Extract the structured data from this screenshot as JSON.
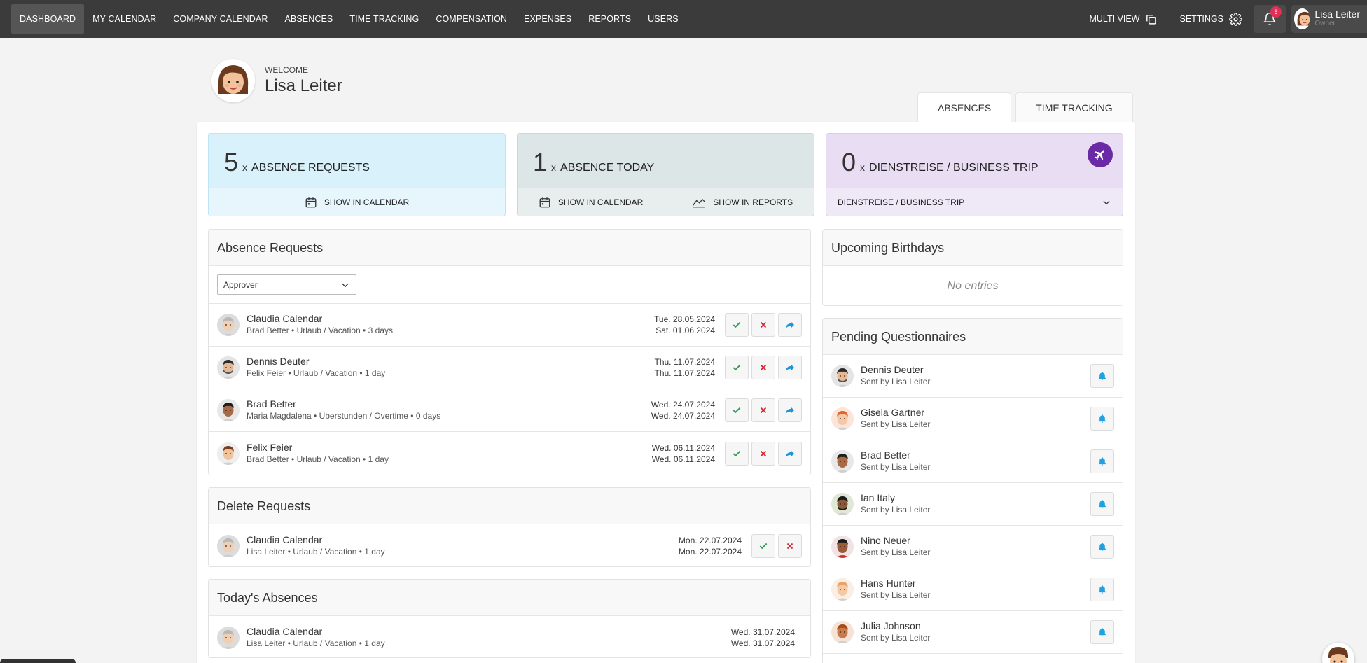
{
  "nav": {
    "items": [
      "DASHBOARD",
      "MY CALENDAR",
      "COMPANY CALENDAR",
      "ABSENCES",
      "TIME TRACKING",
      "COMPENSATION",
      "EXPENSES",
      "REPORTS",
      "USERS"
    ],
    "multi_view": "MULTI VIEW",
    "settings": "SETTINGS",
    "notifications_count": "6",
    "user_name": "Lisa Leiter",
    "user_role": "Owner"
  },
  "welcome": {
    "label": "WELCOME",
    "name": "Lisa Leiter"
  },
  "tabs": {
    "absences": "ABSENCES",
    "time_tracking": "TIME TRACKING"
  },
  "stats": {
    "requests": {
      "count": "5",
      "x": "x",
      "label": "ABSENCE REQUESTS",
      "link1": "SHOW IN CALENDAR"
    },
    "today": {
      "count": "1",
      "x": "x",
      "label": "ABSENCE TODAY",
      "link1": "SHOW IN CALENDAR",
      "link2": "SHOW IN REPORTS"
    },
    "trip": {
      "count": "0",
      "x": "x",
      "label": "DIENSTREISE / BUSINESS TRIP",
      "select": "DIENSTREISE / BUSINESS TRIP"
    }
  },
  "absence_requests": {
    "title": "Absence Requests",
    "filter": "Approver",
    "rows": [
      {
        "name": "Claudia Calendar",
        "sub": "Brad Better • Urlaub / Vacation • 3 days",
        "from": "Tue. 28.05.2024",
        "to": "Sat. 01.06.2024"
      },
      {
        "name": "Dennis Deuter",
        "sub": "Felix Feier • Urlaub / Vacation • 1 day",
        "from": "Thu. 11.07.2024",
        "to": "Thu. 11.07.2024"
      },
      {
        "name": "Brad Better",
        "sub": "Maria Magdalena • Überstunden / Overtime • 0 days",
        "from": "Wed. 24.07.2024",
        "to": "Wed. 24.07.2024"
      },
      {
        "name": "Felix Feier",
        "sub": "Brad Better • Urlaub / Vacation • 1 day",
        "from": "Wed. 06.11.2024",
        "to": "Wed. 06.11.2024"
      }
    ]
  },
  "delete_requests": {
    "title": "Delete Requests",
    "rows": [
      {
        "name": "Claudia Calendar",
        "sub": "Lisa Leiter • Urlaub / Vacation • 1 day",
        "from": "Mon. 22.07.2024",
        "to": "Mon. 22.07.2024"
      }
    ]
  },
  "todays_absences": {
    "title": "Today's Absences",
    "rows": [
      {
        "name": "Claudia Calendar",
        "sub": "Lisa Leiter • Urlaub / Vacation • 1 day",
        "from": "Wed. 31.07.2024",
        "to": "Wed. 31.07.2024"
      }
    ]
  },
  "birthdays": {
    "title": "Upcoming Birthdays",
    "empty": "No entries"
  },
  "questionnaires": {
    "title": "Pending Questionnaires",
    "rows": [
      {
        "name": "Dennis Deuter",
        "sub": "Sent by Lisa Leiter"
      },
      {
        "name": "Gisela Gartner",
        "sub": "Sent by Lisa Leiter"
      },
      {
        "name": "Brad Better",
        "sub": "Sent by Lisa Leiter"
      },
      {
        "name": "Ian Italy",
        "sub": "Sent by Lisa Leiter"
      },
      {
        "name": "Nino Neuer",
        "sub": "Sent by Lisa Leiter"
      },
      {
        "name": "Hans Hunter",
        "sub": "Sent by Lisa Leiter"
      },
      {
        "name": "Julia Johnson",
        "sub": "Sent by Lisa Leiter"
      }
    ]
  },
  "colors": {
    "approve": "#2e9b4f",
    "reject": "#d6202e",
    "forward": "#1e95d8",
    "bell": "#1fa3e0",
    "trip_accent": "#6a2aa6"
  }
}
